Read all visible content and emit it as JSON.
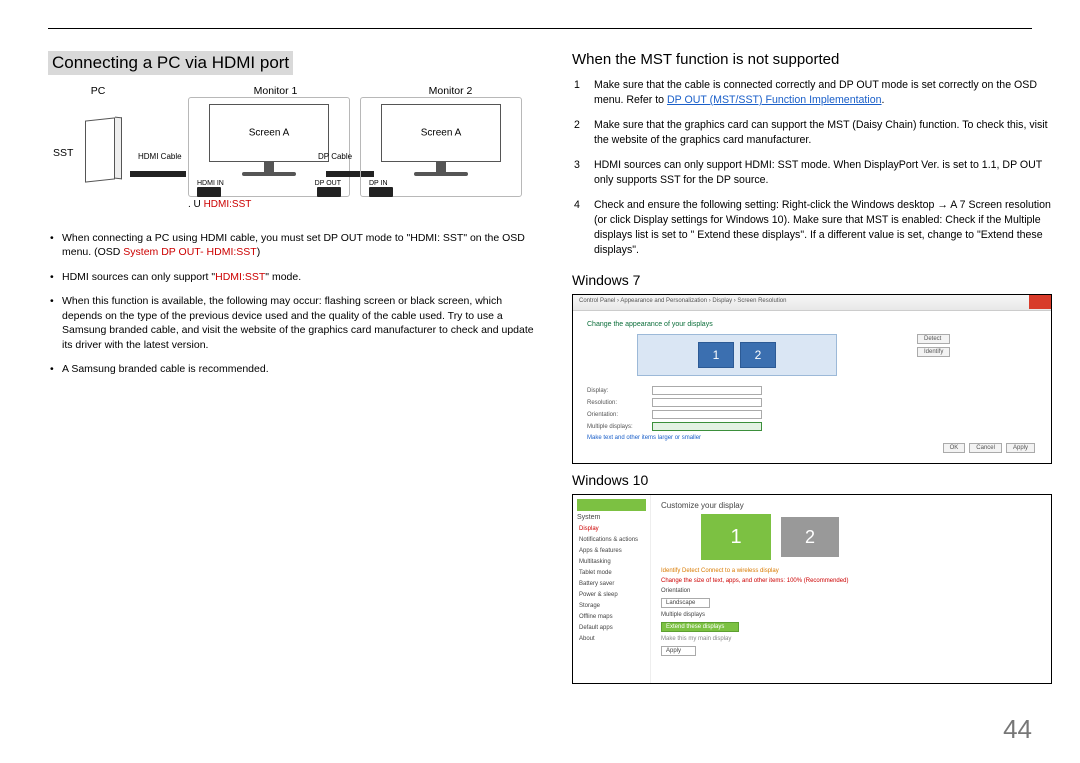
{
  "page_number": "44",
  "left": {
    "heading": "Connecting a PC via HDMI port",
    "diagram": {
      "pc_label": "PC",
      "monitor1_label": "Monitor 1",
      "monitor2_label": "Monitor 2",
      "sst_label": "SST",
      "screen_a": "Screen A",
      "hdmi_cable": "HDMI Cable",
      "dp_cable": "DP Cable",
      "hdmi_in": "HDMI IN",
      "dp_out": "DP OUT",
      "dp_in": "DP IN",
      "u_prefix": ". U ",
      "u_red": "HDMI:SST"
    },
    "notes": [
      {
        "pre": "When connecting a PC using HDMI cable, you must set DP OUT mode to \"HDMI: SST\" on the OSD menu. (OSD ",
        "red1": "System",
        "mid": " ",
        "red2": "DP OUT- HDMI:SST",
        "post": ")"
      },
      {
        "pre": "HDMI sources can only support \"",
        "red1": "HDMI:SST",
        "post": "\" mode."
      },
      {
        "text": "When this function is available, the following may occur: flashing screen or black screen, which depends on the type of the previous device used and the quality of the cable used. Try to use a Samsung branded cable, and visit the website of the graphics card manufacturer to check and update its driver with the latest version."
      },
      {
        "text": "A Samsung branded cable is recommended."
      }
    ]
  },
  "right": {
    "heading": "When the MST function is not supported",
    "steps": [
      {
        "pre": "Make sure that the cable is connected correctly and DP OUT mode is set correctly on the OSD menu. Refer to ",
        "link": "DP OUT (MST/SST) Function Implementation",
        "post": "."
      },
      {
        "text": "Make sure that the graphics card can support the MST (Daisy Chain) function. To check this, visit the website of the graphics card manufacturer."
      },
      {
        "text": "HDMI sources can only support  HDMI: SST  mode. When DisplayPort Ver. is set to 1.1, DP OUT only supports SST for the DP source."
      },
      {
        "text": "Check and ensure the following setting: Right-click the  Windows desktop → A 7 Screen resolution (or click Display settings for Windows 10). Make sure that MST is enabled: Check if the Multiple displays list is set to \" Extend these displays\". If a different value is set, change to \"Extend these displays\"."
      }
    ],
    "win7": {
      "title": "Windows 7",
      "breadcrumb": "Control Panel › Appearance and Personalization › Display › Screen Resolution",
      "header": "Change the appearance of your displays",
      "mon1": "1",
      "mon2": "2",
      "rows": {
        "display": "Display:",
        "resolution": "Resolution:",
        "orientation": "Orientation:",
        "multiple": "Multiple displays:"
      },
      "identify": "Identify",
      "detect": "Detect",
      "link": "Make text and other items larger or smaller",
      "ok": "OK",
      "cancel": "Cancel",
      "apply": "Apply"
    },
    "win10": {
      "title": "Windows 10",
      "system": "System",
      "side": [
        "Display",
        "Notifications & actions",
        "Apps & features",
        "Multitasking",
        "Tablet mode",
        "Battery saver",
        "Power & sleep",
        "Storage",
        "Offline maps",
        "Default apps",
        "About"
      ],
      "m1": "1",
      "m2": "2",
      "custom": "Customize your display",
      "ida": "Identify   Detect   Connect to a wireless display",
      "change": "Change the size of text, apps, and other items: 100% (Recommended)",
      "orient": "Orientation",
      "landscape": "Landscape",
      "multi": "Multiple displays",
      "extend": "Extend these displays",
      "main": "Make this my main display",
      "apply": "Apply"
    }
  }
}
